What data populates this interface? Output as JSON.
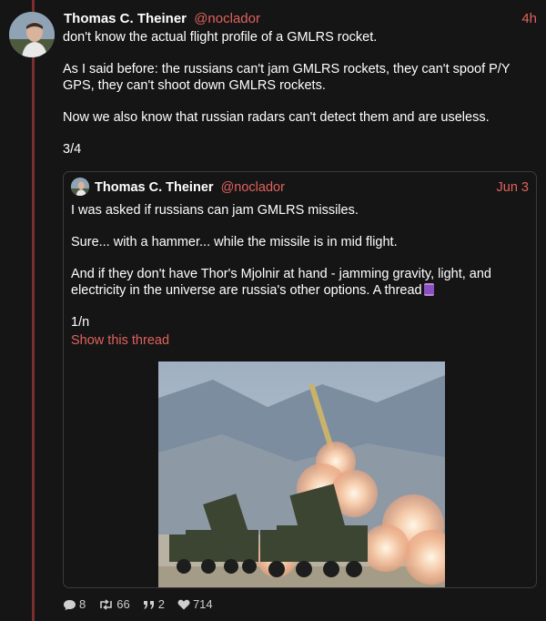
{
  "post": {
    "author_name": "Thomas C. Theiner",
    "handle": "@noclador",
    "time": "4h",
    "paragraphs": [
      "don't know the actual flight profile of a GMLRS rocket.",
      "As I said before: the russians can't jam GMLRS rockets, they can't spoof P/Y GPS, they can't shoot down GMLRS rockets.",
      "Now we also know that russian radars can't detect them and are useless.",
      "3/4"
    ]
  },
  "quoted": {
    "author_name": "Thomas C. Theiner",
    "handle": "@noclador",
    "time": "Jun 3",
    "paragraphs": [
      "I was asked if russians can jam GMLRS missiles.",
      "Sure... with a hammer... while the missile is in mid flight.",
      "And if they don't have Thor's Mjolnir at hand - jamming gravity, light, and electricity in the universe are russia's other options. A thread"
    ],
    "counter": "1/n",
    "show_thread": "Show this thread"
  },
  "actions": {
    "replies": "8",
    "boosts": "66",
    "quotes": "2",
    "likes": "714"
  },
  "colors": {
    "accent": "#e0625c",
    "background": "#151515",
    "thread_line": "#7a2e2e"
  }
}
